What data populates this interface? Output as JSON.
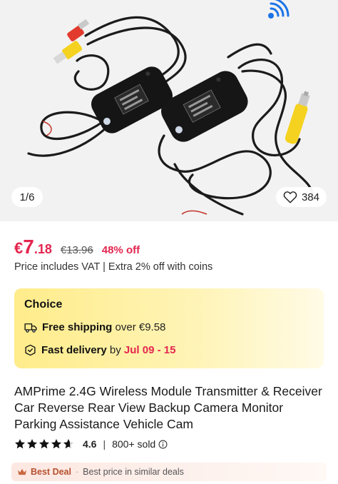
{
  "gallery": {
    "counter": "1/6",
    "favorites_count": "384"
  },
  "price": {
    "currency": "€",
    "integer": "7",
    "decimal": ".18",
    "original": "€13.96",
    "discount": "48% off",
    "note": "Price includes VAT | Extra 2% off with coins"
  },
  "choice": {
    "title": "Choice",
    "shipping_bold": "Free shipping",
    "shipping_rest": " over €9.58",
    "delivery_bold": "Fast delivery",
    "delivery_by": " by ",
    "delivery_dates": "Jul 09 - 15"
  },
  "product": {
    "title": "AMPrime 2.4G Wireless Module Transmitter & Receiver Car Reverse Rear View Backup Camera Monitor Parking Assistance Vehicle Cam"
  },
  "rating": {
    "stars": 4.6,
    "score": "4.6",
    "separator": "|",
    "sold": "800+ sold"
  },
  "deal": {
    "label": "Best Deal",
    "separator": "·",
    "description": "Best price in similar deals"
  },
  "colors": {
    "accent_red": "#e4254f",
    "choice_yellow": "#ffec8a",
    "deal_brown": "#b5512f",
    "wifi_blue": "#1a73e8"
  },
  "icons": {
    "favorite": "heart-outline-icon",
    "shipping": "truck-icon",
    "delivery": "box-check-icon",
    "rating": "star-icon",
    "info": "info-circle-icon",
    "deal": "crown-icon",
    "wireless": "wifi-signal-icon"
  }
}
